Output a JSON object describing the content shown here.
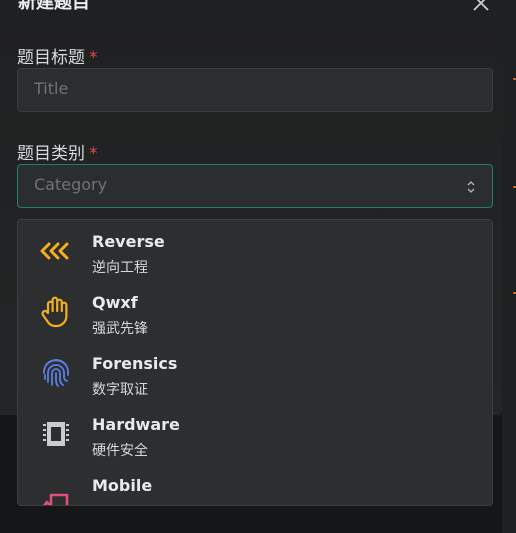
{
  "modal": {
    "title": "新建题目",
    "title_field": {
      "label": "题目标题",
      "required_mark": "*",
      "placeholder": "Title"
    },
    "category_field": {
      "label": "题目类别",
      "required_mark": "*",
      "placeholder": "Category"
    }
  },
  "categories": [
    {
      "name": "Reverse",
      "desc": "逆向工程",
      "icon": "chevrons-left-icon",
      "color": "#f2b01e"
    },
    {
      "name": "Qwxf",
      "desc": "强武先锋",
      "icon": "hand-icon",
      "color": "#f2b01e"
    },
    {
      "name": "Forensics",
      "desc": "数字取证",
      "icon": "fingerprint-icon",
      "color": "#5c7ee6"
    },
    {
      "name": "Hardware",
      "desc": "硬件安全",
      "icon": "chip-icon",
      "color": "#c9cccf"
    },
    {
      "name": "Mobile",
      "desc": "",
      "icon": "device-mobile-icon",
      "color": "#e0507a"
    }
  ],
  "colors": {
    "focus_border": "#1f7f67",
    "required": "#e0484b"
  }
}
